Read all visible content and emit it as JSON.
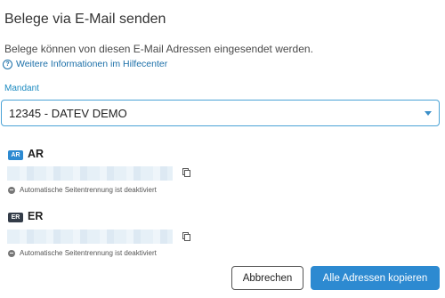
{
  "dialog": {
    "title": "Belege via E-Mail senden",
    "description": "Belege können von diesen E-Mail Adressen eingesendet werden.",
    "help_link": "Weitere Informationen im Hilfecenter"
  },
  "mandant": {
    "label": "Mandant",
    "selected": "12345 - DATEV DEMO"
  },
  "sections": [
    {
      "badge": "AR",
      "title": "AR",
      "status": "Automatische Seitentrennung ist deaktiviert"
    },
    {
      "badge": "ER",
      "title": "ER",
      "status": "Automatische Seitentrennung ist deaktiviert"
    }
  ],
  "buttons": {
    "cancel": "Abbrechen",
    "copy_all": "Alle Adressen kopieren"
  },
  "colors": {
    "accent": "#2d8ad1",
    "link": "#1b6fa8",
    "badge_er": "#333c48"
  },
  "icons": {
    "help": "help-circle-icon",
    "copy": "copy-icon",
    "status": "minus-circle-icon",
    "dropdown": "caret-down-icon"
  }
}
